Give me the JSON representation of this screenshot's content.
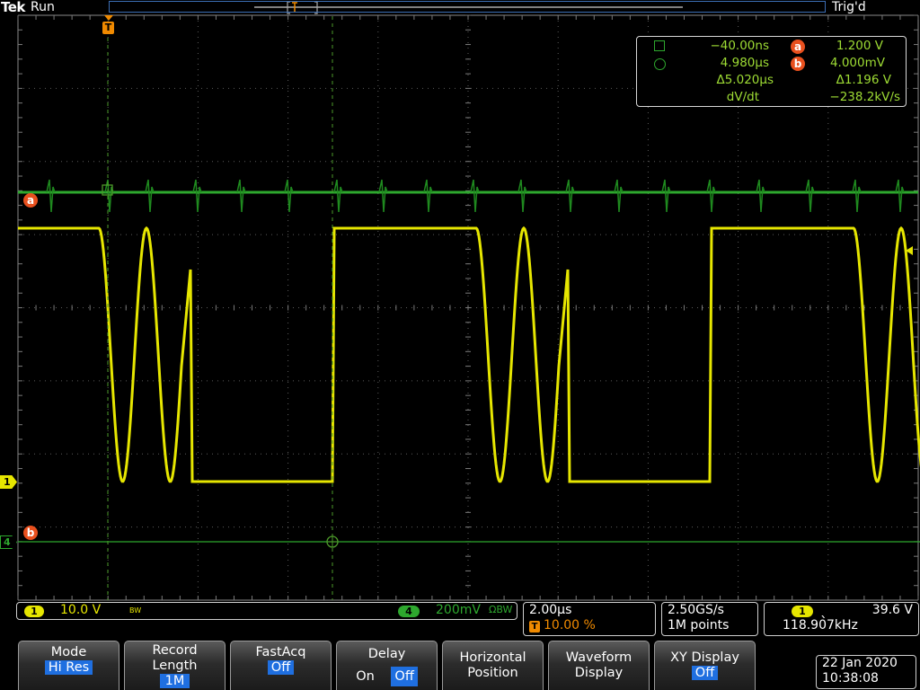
{
  "topbar": {
    "brand": "Tek",
    "run_state": "Run",
    "trigger_state": "Trig'd"
  },
  "markers": {
    "trigger": "T",
    "ref_a": "a",
    "ref_b": "b",
    "ch1": "1",
    "ch4": "4"
  },
  "cursor_readout": {
    "t1": "−40.00ns",
    "t2": "4.980µs",
    "dt": "Δ5.020µs",
    "dvdt_label": "dV/dt",
    "a_label": "a",
    "a_val": "1.200 V",
    "b_label": "b",
    "b_val": "4.000mV",
    "dv": "Δ1.196 V",
    "dvdt_val": "−238.2kV/s"
  },
  "status": {
    "ch1_num": "1",
    "ch1_scale": "10.0 V",
    "ch1_bw": "BW",
    "ch4_num": "4",
    "ch4_scale": "200mV",
    "ch4_coupling": "ΩBW",
    "timebase": "2.00µs",
    "trig_pos_icon": "T",
    "trig_pos": "10.00 %",
    "sample_rate": "2.50GS/s",
    "record": "1M points",
    "trig_src": "1",
    "trig_slope": "ˎ",
    "trig_level": "39.6 V",
    "frequency": "118.907kHz"
  },
  "menu": {
    "mode": {
      "label": "Mode",
      "value": "Hi Res"
    },
    "record": {
      "label1": "Record",
      "label2": "Length",
      "value": "1M"
    },
    "fastacq": {
      "label": "FastAcq",
      "value": "Off"
    },
    "delay": {
      "label": "Delay",
      "on": "On",
      "off": "Off"
    },
    "horiz": {
      "label1": "Horizontal",
      "label2": "Position"
    },
    "wfm": {
      "label1": "Waveform",
      "label2": "Display"
    },
    "xy": {
      "label": "XY Display",
      "value": "Off"
    }
  },
  "datetime": {
    "date": "22 Jan 2020",
    "time": "10:38:08"
  },
  "colors": {
    "ch1": "#e8e800",
    "ch4": "#2ea82e",
    "ref_bubble": "#e8501e",
    "grid": "#707070",
    "highlight": "#1f6fe0"
  }
}
